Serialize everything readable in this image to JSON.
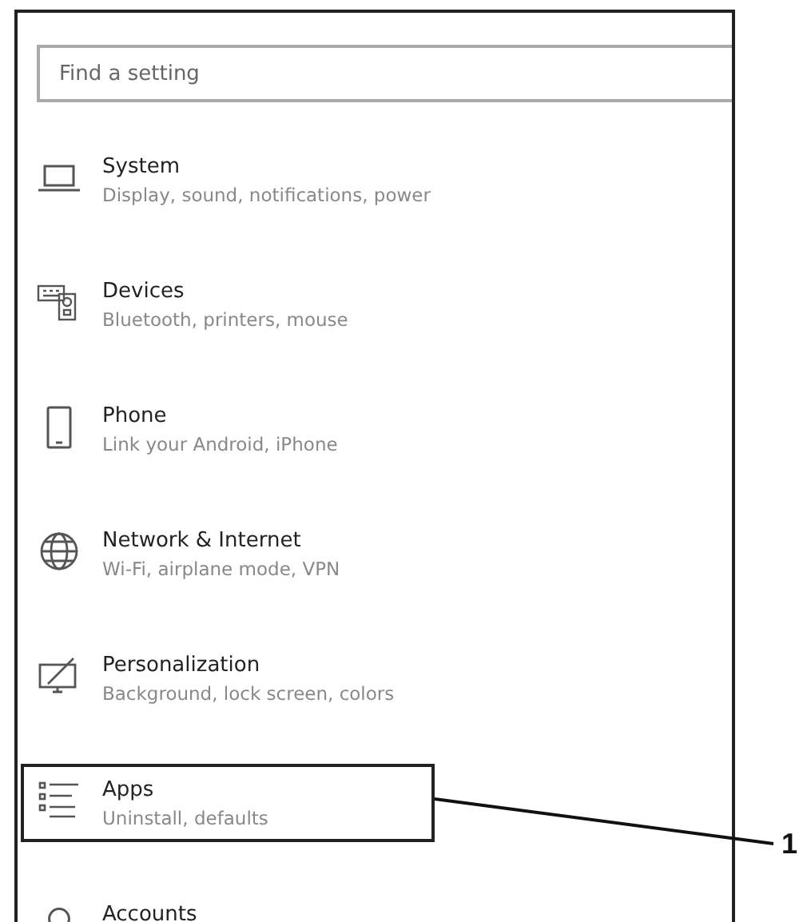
{
  "search": {
    "placeholder": "Find a setting"
  },
  "items": [
    {
      "kind": "system",
      "title": "System",
      "subtitle": "Display, sound, notifications, power",
      "highlighted": false
    },
    {
      "kind": "devices",
      "title": "Devices",
      "subtitle": "Bluetooth, printers, mouse",
      "highlighted": false
    },
    {
      "kind": "phone",
      "title": "Phone",
      "subtitle": "Link your Android, iPhone",
      "highlighted": false
    },
    {
      "kind": "network",
      "title": "Network & Internet",
      "subtitle": "Wi-Fi, airplane mode, VPN",
      "highlighted": false
    },
    {
      "kind": "personalization",
      "title": "Personalization",
      "subtitle": "Background, lock screen, colors",
      "highlighted": false
    },
    {
      "kind": "apps",
      "title": "Apps",
      "subtitle": "Uninstall, defaults",
      "highlighted": true
    },
    {
      "kind": "accounts",
      "title": "Accounts",
      "highlighted": false
    }
  ],
  "callout": {
    "label": "1"
  }
}
